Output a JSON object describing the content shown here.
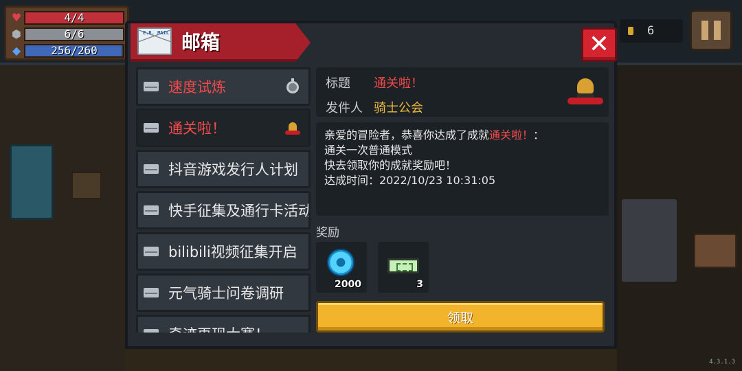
{
  "hud": {
    "hp": {
      "label": "4/4",
      "value": 4,
      "max": 4,
      "color": "#c0303a"
    },
    "armor": {
      "label": "6/6",
      "value": 6,
      "max": 6,
      "color": "#8a8f96"
    },
    "energy": {
      "label": "256/260",
      "value": 256,
      "max": 260,
      "color": "#3f69b8"
    },
    "icons": [
      "heart-icon",
      "shield-icon",
      "energy-gem-icon"
    ]
  },
  "coins": {
    "count": "6",
    "icon": "coin-icon"
  },
  "pause": {
    "icon": "pause-icon"
  },
  "version": "4.3.1.3",
  "mailbox": {
    "title": "邮箱",
    "envelope_tag": "E.R. MAIL",
    "close_icon": "close-icon",
    "mails": [
      {
        "title": "速度试炼",
        "highlight": true,
        "badge": "stopwatch-icon",
        "selected": false
      },
      {
        "title": "通关啦！",
        "highlight": true,
        "badge": "knight-helmet-icon",
        "selected": true
      },
      {
        "title": "抖音游戏发行人计划",
        "highlight": false,
        "badge": "",
        "selected": false
      },
      {
        "title": "快手征集及通行卡活动",
        "highlight": false,
        "badge": "",
        "selected": false
      },
      {
        "title": "bilibili视频征集开启",
        "highlight": false,
        "badge": "",
        "selected": false
      },
      {
        "title": "元气骑士问卷调研",
        "highlight": false,
        "badge": "",
        "selected": false
      },
      {
        "title": "奇迹再现大赛！",
        "highlight": false,
        "badge": "",
        "selected": false
      }
    ],
    "detail": {
      "subject_label": "标题",
      "subject": "通关啦！",
      "sender_label": "发件人",
      "sender": "骑士公会",
      "body_lines": [
        {
          "pre": "亲爱的冒险者，恭喜你达成了成就",
          "red": "通关啦！",
          "post": "："
        },
        {
          "pre": "通关一次普通模式"
        },
        {
          "pre": "快去领取你的成就奖励吧！"
        },
        {
          "pre": "达成时间：2022/10/23 10:31:05"
        }
      ],
      "reward_label": "奖励",
      "rewards": [
        {
          "icon": "blue-gem-icon",
          "qty": "2000"
        },
        {
          "icon": "ticket-icon",
          "qty": "3"
        }
      ],
      "claim_label": "领取"
    }
  }
}
